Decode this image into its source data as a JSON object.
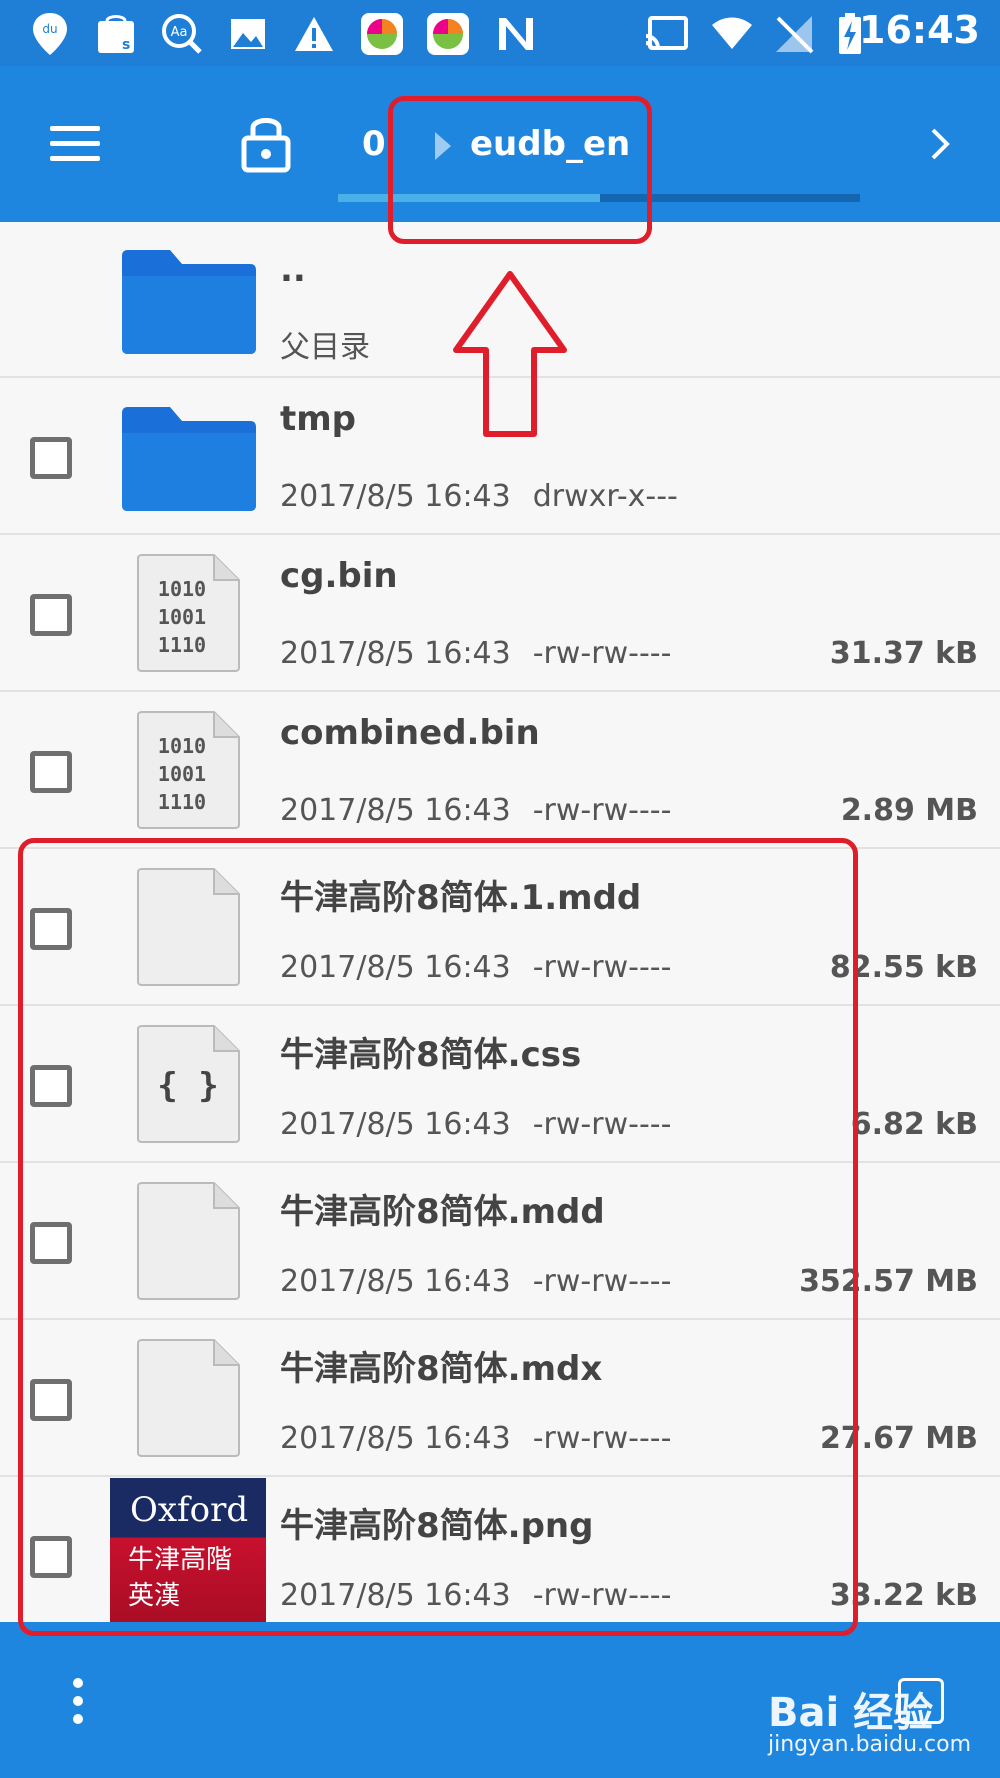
{
  "status_bar": {
    "time": "16:43",
    "icons": [
      "du-map-icon",
      "shopping-bag-icon",
      "dictionary-icon",
      "image-icon",
      "warning-icon",
      "app-colorful-icon",
      "app-colorful-icon-2",
      "n-icon",
      "cast-icon",
      "wifi-icon",
      "no-sim-icon",
      "battery-charging-icon"
    ]
  },
  "toolbar": {
    "crumb_root": "0",
    "crumb_current": "eudb_en",
    "progress": 0.5
  },
  "files": [
    {
      "name": "..",
      "meta": "父目录",
      "type": "parent-folder",
      "date": "",
      "perm": "",
      "size": ""
    },
    {
      "name": "tmp",
      "type": "folder",
      "date": "2017/8/5 16:43",
      "perm": "drwxr-x---",
      "size": ""
    },
    {
      "name": "cg.bin",
      "type": "binary",
      "date": "2017/8/5 16:43",
      "perm": "-rw-rw----",
      "size": "31.37 kB"
    },
    {
      "name": "combined.bin",
      "type": "binary",
      "date": "2017/8/5 16:43",
      "perm": "-rw-rw----",
      "size": "2.89 MB"
    },
    {
      "name": "牛津高阶8简体.1.mdd",
      "type": "blank",
      "date": "2017/8/5 16:43",
      "perm": "-rw-rw----",
      "size": "82.55 kB"
    },
    {
      "name": "牛津高阶8简体.css",
      "type": "css",
      "date": "2017/8/5 16:43",
      "perm": "-rw-rw----",
      "size": "6.82 kB"
    },
    {
      "name": "牛津高阶8简体.mdd",
      "type": "blank",
      "date": "2017/8/5 16:43",
      "perm": "-rw-rw----",
      "size": "352.57 MB"
    },
    {
      "name": "牛津高阶8简体.mdx",
      "type": "blank",
      "date": "2017/8/5 16:43",
      "perm": "-rw-rw----",
      "size": "27.67 MB"
    },
    {
      "name": "牛津高阶8简体.png",
      "type": "image",
      "date": "2017/8/5 16:43",
      "perm": "-rw-rw----",
      "size": "33.22 kB"
    }
  ],
  "binary_icon_lines": [
    "1010",
    "1001",
    "1110"
  ],
  "css_icon_glyph": "{ }",
  "oxford_thumb": {
    "title": "Oxford",
    "line1": "牛津高階",
    "line2": "英漢"
  },
  "watermark": {
    "brand": "Bai 经验",
    "url": "jingyan.baidu.com"
  },
  "colors": {
    "accent": "#1f86e0",
    "status": "#1f7fd6",
    "annotation": "#e01e2b"
  }
}
